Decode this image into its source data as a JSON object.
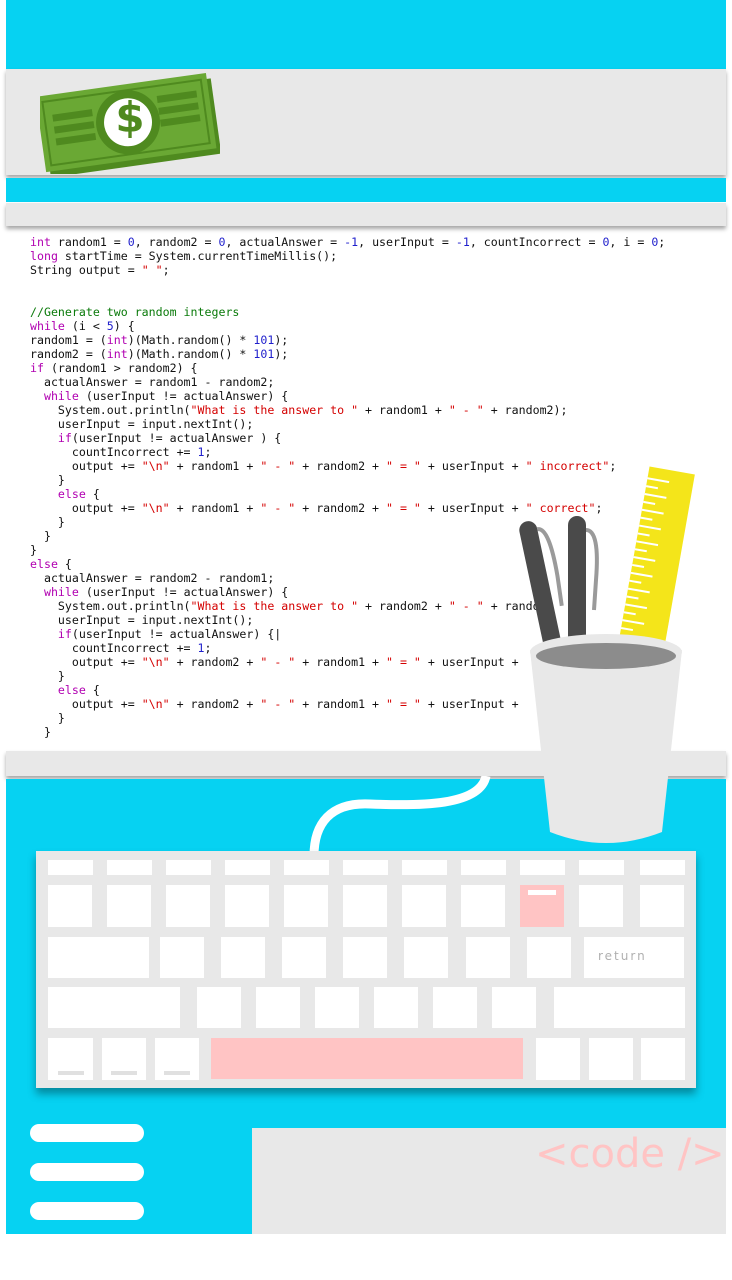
{
  "colors": {
    "accent_blue": "#06d2f2",
    "panel_grey": "#e8e8e8",
    "pink": "#ffc4c4",
    "money_green": "#6aa834",
    "ruler_yellow": "#f4e51a"
  },
  "code_lines": [
    [
      [
        "int",
        "kw"
      ],
      [
        " random1 = ",
        ""
      ],
      [
        "0",
        "num"
      ],
      [
        ", random2 = ",
        ""
      ],
      [
        "0",
        "num"
      ],
      [
        ", actualAnswer = ",
        ""
      ],
      [
        "-1",
        "num"
      ],
      [
        ", userInput = ",
        ""
      ],
      [
        "-1",
        "num"
      ],
      [
        ", countIncorrect = ",
        ""
      ],
      [
        "0",
        "num"
      ],
      [
        ", i = ",
        ""
      ],
      [
        "0",
        "num"
      ],
      [
        ";",
        ""
      ]
    ],
    [
      [
        "long",
        "kw"
      ],
      [
        " startTime = System.currentTimeMillis();",
        ""
      ]
    ],
    [
      [
        "String output = ",
        ""
      ],
      [
        "\" \"",
        "str"
      ],
      [
        ";",
        ""
      ]
    ],
    [],
    [],
    [
      [
        "//Generate two random integers",
        "cm"
      ]
    ],
    [
      [
        "while",
        "kw"
      ],
      [
        " (i < ",
        ""
      ],
      [
        "5",
        "num"
      ],
      [
        ") {",
        ""
      ]
    ],
    [
      [
        "random1 = (",
        ""
      ],
      [
        "int",
        "kw"
      ],
      [
        ")(Math.random() * ",
        ""
      ],
      [
        "101",
        "num"
      ],
      [
        ");",
        ""
      ]
    ],
    [
      [
        "random2 = (",
        ""
      ],
      [
        "int",
        "kw"
      ],
      [
        ")(Math.random() * ",
        ""
      ],
      [
        "101",
        "num"
      ],
      [
        ");",
        ""
      ]
    ],
    [
      [
        "if",
        "kw"
      ],
      [
        " (random1 > random2) {",
        ""
      ]
    ],
    [
      [
        "  actualAnswer = random1 - random2;",
        ""
      ]
    ],
    [
      [
        "  ",
        ""
      ],
      [
        "while",
        "kw"
      ],
      [
        " (userInput != actualAnswer) {",
        ""
      ]
    ],
    [
      [
        "    System.out.println(",
        ""
      ],
      [
        "\"What is the answer to \"",
        "str"
      ],
      [
        " + random1 + ",
        ""
      ],
      [
        "\" - \"",
        "str"
      ],
      [
        " + random2);",
        ""
      ]
    ],
    [
      [
        "    userInput = input.nextInt();",
        ""
      ]
    ],
    [
      [
        "    ",
        ""
      ],
      [
        "if",
        "kw"
      ],
      [
        "(userInput != actualAnswer ) {",
        ""
      ]
    ],
    [
      [
        "      countIncorrect += ",
        ""
      ],
      [
        "1",
        "num"
      ],
      [
        ";",
        ""
      ]
    ],
    [
      [
        "      output += ",
        ""
      ],
      [
        "\"\\n\"",
        "str"
      ],
      [
        " + random1 + ",
        ""
      ],
      [
        "\" - \"",
        "str"
      ],
      [
        " + random2 + ",
        ""
      ],
      [
        "\" = \"",
        "str"
      ],
      [
        " + userInput + ",
        ""
      ],
      [
        "\" incorrect\"",
        "str"
      ],
      [
        ";",
        ""
      ]
    ],
    [
      [
        "    }",
        ""
      ]
    ],
    [
      [
        "    ",
        ""
      ],
      [
        "else",
        "kw"
      ],
      [
        " {",
        ""
      ]
    ],
    [
      [
        "      output += ",
        ""
      ],
      [
        "\"\\n\"",
        "str"
      ],
      [
        " + random1 + ",
        ""
      ],
      [
        "\" - \"",
        "str"
      ],
      [
        " + random2 + ",
        ""
      ],
      [
        "\" = \"",
        "str"
      ],
      [
        " + userInput + ",
        ""
      ],
      [
        "\" correct\"",
        "str"
      ],
      [
        ";",
        ""
      ]
    ],
    [
      [
        "    }",
        ""
      ]
    ],
    [
      [
        "  }",
        ""
      ]
    ],
    [
      [
        "}",
        ""
      ]
    ],
    [
      [
        "else",
        "kw"
      ],
      [
        " {",
        ""
      ]
    ],
    [
      [
        "  actualAnswer = random2 - random1;",
        ""
      ]
    ],
    [
      [
        "  ",
        ""
      ],
      [
        "while",
        "kw"
      ],
      [
        " (userInput != actualAnswer) {",
        ""
      ]
    ],
    [
      [
        "    System.out.println(",
        ""
      ],
      [
        "\"What is the answer to \"",
        "str"
      ],
      [
        " + random2 + ",
        ""
      ],
      [
        "\" - \"",
        "str"
      ],
      [
        " + random1",
        ""
      ]
    ],
    [
      [
        "    userInput = input.nextInt();",
        ""
      ]
    ],
    [
      [
        "    ",
        ""
      ],
      [
        "if",
        "kw"
      ],
      [
        "(userInput != actualAnswer) {|",
        ""
      ]
    ],
    [
      [
        "      countIncorrect += ",
        ""
      ],
      [
        "1",
        "num"
      ],
      [
        ";",
        ""
      ]
    ],
    [
      [
        "      output += ",
        ""
      ],
      [
        "\"\\n\"",
        "str"
      ],
      [
        " + random2 + ",
        ""
      ],
      [
        "\" - \"",
        "str"
      ],
      [
        " + random1 + ",
        ""
      ],
      [
        "\" = \"",
        "str"
      ],
      [
        " + userInput +",
        ""
      ]
    ],
    [
      [
        "    }",
        ""
      ]
    ],
    [
      [
        "    ",
        ""
      ],
      [
        "else",
        "kw"
      ],
      [
        " {",
        ""
      ]
    ],
    [
      [
        "      output += ",
        ""
      ],
      [
        "\"\\n\"",
        "str"
      ],
      [
        " + random2 + ",
        ""
      ],
      [
        "\" - \"",
        "str"
      ],
      [
        " + random1 + ",
        ""
      ],
      [
        "\" = \"",
        "str"
      ],
      [
        " + userInput +",
        ""
      ]
    ],
    [
      [
        "    }",
        ""
      ]
    ],
    [
      [
        "  }",
        ""
      ]
    ]
  ],
  "keyboard": {
    "return_label": "return"
  },
  "code_tag": "<code />",
  "dollar_symbol": "$"
}
